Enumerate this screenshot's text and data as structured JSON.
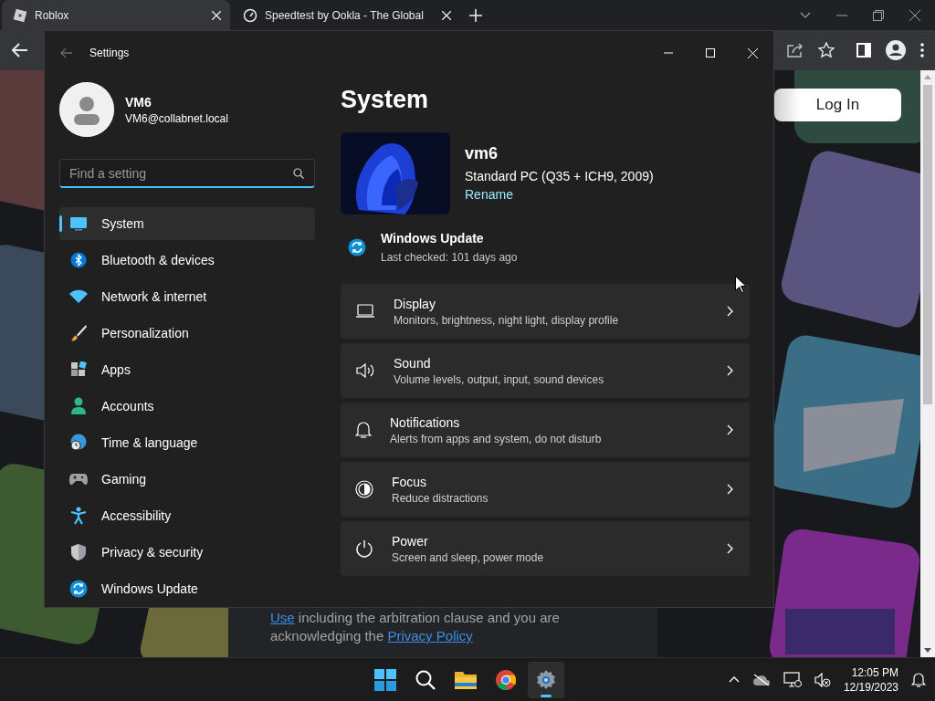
{
  "browser": {
    "tabs": [
      {
        "title": "Roblox",
        "selected": true
      },
      {
        "title": "Speedtest by Ookla - The Global",
        "selected": false
      }
    ],
    "login_button": "Log In",
    "terms": {
      "link_1": "Use",
      "text_1": "including the arbitration clause and you are acknowledging the",
      "link_2": "Privacy Policy"
    }
  },
  "settings": {
    "title": "Settings",
    "user": {
      "name": "VM6",
      "email": "VM6@collabnet.local"
    },
    "search": {
      "placeholder": "Find a setting",
      "focused": true
    },
    "nav": [
      {
        "label": "System",
        "selected": true
      },
      {
        "label": "Bluetooth & devices",
        "selected": false
      },
      {
        "label": "Network & internet",
        "selected": false
      },
      {
        "label": "Personalization",
        "selected": false
      },
      {
        "label": "Apps",
        "selected": false
      },
      {
        "label": "Accounts",
        "selected": false
      },
      {
        "label": "Time & language",
        "selected": false
      },
      {
        "label": "Gaming",
        "selected": false
      },
      {
        "label": "Accessibility",
        "selected": false
      },
      {
        "label": "Privacy & security",
        "selected": false
      },
      {
        "label": "Windows Update",
        "selected": false
      }
    ],
    "page_title": "System",
    "device": {
      "name": "vm6",
      "model": "Standard PC (Q35 + ICH9, 2009)",
      "rename": "Rename"
    },
    "update": {
      "title": "Windows Update",
      "status": "Last checked: 101 days ago"
    },
    "cards": [
      {
        "title": "Display",
        "subtitle": "Monitors, brightness, night light, display profile"
      },
      {
        "title": "Sound",
        "subtitle": "Volume levels, output, input, sound devices"
      },
      {
        "title": "Notifications",
        "subtitle": "Alerts from apps and system, do not disturb"
      },
      {
        "title": "Focus",
        "subtitle": "Reduce distractions"
      },
      {
        "title": "Power",
        "subtitle": "Screen and sleep, power mode"
      }
    ]
  },
  "taskbar": {
    "apps": [
      {
        "selected": false
      },
      {
        "selected": false
      },
      {
        "selected": false
      },
      {
        "selected": false
      },
      {
        "selected": true
      }
    ],
    "time": "12:05 PM",
    "date": "12/19/2023"
  }
}
